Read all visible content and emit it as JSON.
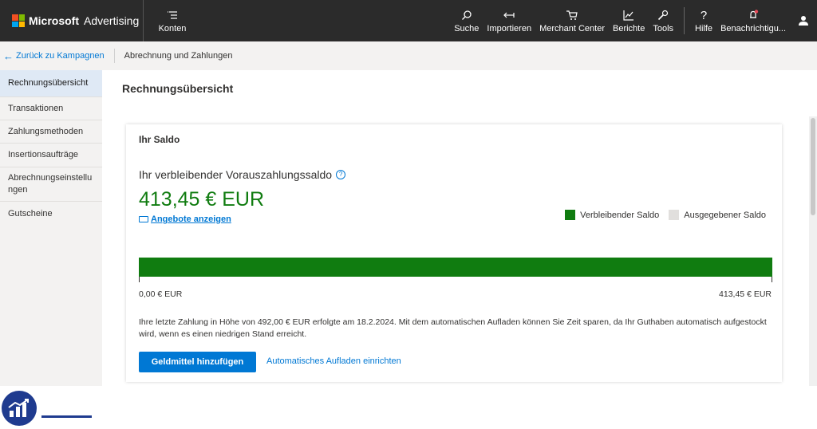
{
  "header": {
    "brand_ms": "Microsoft",
    "brand_product": "Advertising",
    "konten_label": "Konten",
    "nav": [
      {
        "label": "Suche",
        "icon": "search-icon"
      },
      {
        "label": "Importieren",
        "icon": "import-icon"
      },
      {
        "label": "Merchant Center",
        "icon": "cart-icon"
      },
      {
        "label": "Berichte",
        "icon": "chart-icon"
      },
      {
        "label": "Tools",
        "icon": "wrench-icon"
      }
    ],
    "help_label": "Hilfe",
    "notifications_label": "Benachrichtigu...",
    "colors": {
      "bar": "#2b2b2b",
      "notification_dot": "#e74856"
    }
  },
  "breadcrumb": {
    "back_label": "Zurück zu Kampagnen",
    "current": "Abrechnung und Zahlungen"
  },
  "sidebar": {
    "items": [
      {
        "label": "Rechnungsübersicht",
        "active": true
      },
      {
        "label": "Transaktionen",
        "active": false
      },
      {
        "label": "Zahlungsmethoden",
        "active": false
      },
      {
        "label": "Insertionsaufträge",
        "active": false
      },
      {
        "label": "Abrechnungseinstellungen",
        "active": false
      },
      {
        "label": "Gutscheine",
        "active": false
      }
    ]
  },
  "main": {
    "page_title": "Rechnungsübersicht",
    "card": {
      "title": "Ihr Saldo",
      "balance_label": "Ihr verbleibender Vorauszahlungssaldo",
      "amount": "413,45 € EUR",
      "offers_link": "Angebote anzeigen",
      "legend": {
        "remaining": "Verbleibender Saldo",
        "spent": "Ausgegebener Saldo",
        "remaining_color": "#107c10",
        "spent_color": "#e1dfdd"
      },
      "bar": {
        "remaining_fraction": 1.0,
        "min_label": "0,00 € EUR",
        "max_label": "413,45 € EUR"
      },
      "note": "Ihre letzte Zahlung in Höhe von 492,00 € EUR erfolgte am 18.2.2024. Mit dem automatischen Aufladen können Sie Zeit sparen, da Ihr Guthaben automatisch aufgestockt wird, wenn es einen niedrigen Stand erreicht.",
      "primary_button": "Geldmittel hinzufügen",
      "secondary_link": "Automatisches Aufladen einrichten"
    }
  }
}
